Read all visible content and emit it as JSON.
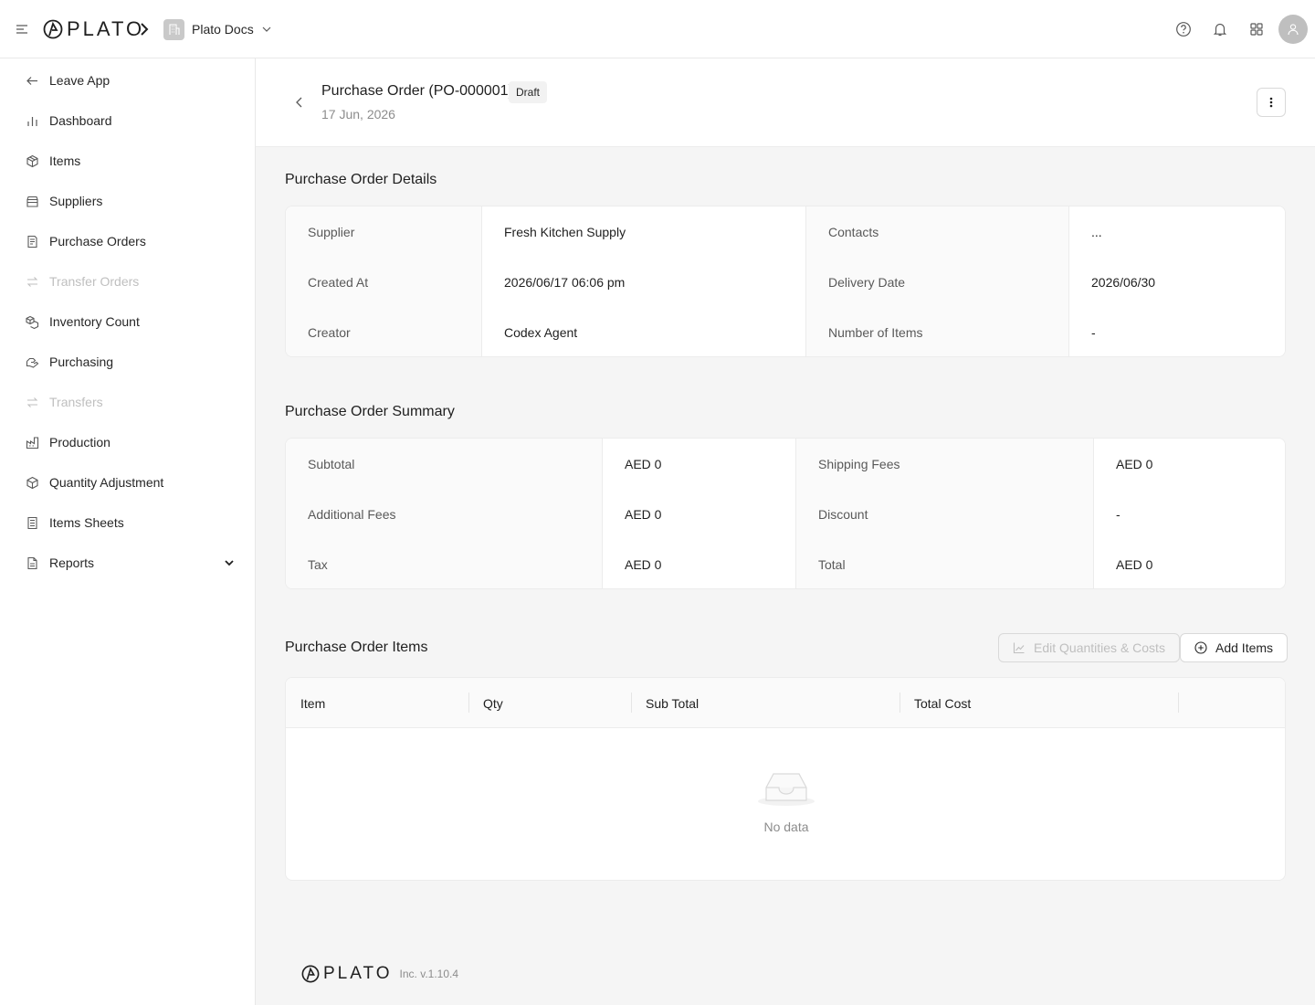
{
  "topbar": {
    "logo_text": "PLATO",
    "workspace_name": "Plato Docs"
  },
  "sidebar": {
    "items": [
      {
        "label": "Leave App",
        "icon": "arrow-left-icon",
        "disabled": false
      },
      {
        "label": "Dashboard",
        "icon": "bar-chart-icon",
        "disabled": false
      },
      {
        "label": "Items",
        "icon": "box-icon",
        "disabled": false
      },
      {
        "label": "Suppliers",
        "icon": "store-icon",
        "disabled": false
      },
      {
        "label": "Purchase Orders",
        "icon": "receipt-icon",
        "disabled": false
      },
      {
        "label": "Transfer Orders",
        "icon": "transfer-icon",
        "disabled": true
      },
      {
        "label": "Inventory Count",
        "icon": "boxes-icon",
        "disabled": false
      },
      {
        "label": "Purchasing",
        "icon": "purchasing-icon",
        "disabled": false
      },
      {
        "label": "Transfers",
        "icon": "transfer-icon",
        "disabled": true
      },
      {
        "label": "Production",
        "icon": "factory-icon",
        "disabled": false
      },
      {
        "label": "Quantity Adjustment",
        "icon": "box-icon",
        "disabled": false
      },
      {
        "label": "Items Sheets",
        "icon": "sheet-icon",
        "disabled": false
      },
      {
        "label": "Reports",
        "icon": "report-icon",
        "disabled": false
      }
    ]
  },
  "header": {
    "title": "Purchase Order (PO-000001)",
    "status": "Draft",
    "date": "17 Jun, 2026"
  },
  "details": {
    "title": "Purchase Order Details",
    "rows": [
      {
        "l1": "Supplier",
        "v1": "Fresh Kitchen Supply",
        "l2": "Contacts",
        "v2": "..."
      },
      {
        "l1": "Created At",
        "v1": "2026/06/17 06:06 pm",
        "l2": "Delivery Date",
        "v2": "2026/06/30"
      },
      {
        "l1": "Creator",
        "v1": "Codex Agent",
        "l2": "Number of Items",
        "v2": "-"
      }
    ]
  },
  "summary": {
    "title": "Purchase Order Summary",
    "rows": [
      {
        "l1": "Subtotal",
        "v1": "AED 0",
        "l2": "Shipping Fees",
        "v2": "AED 0"
      },
      {
        "l1": "Additional Fees",
        "v1": "AED 0",
        "l2": "Discount",
        "v2": "-"
      },
      {
        "l1": "Tax",
        "v1": "AED 0",
        "l2": "Total",
        "v2": "AED 0"
      }
    ]
  },
  "items": {
    "title": "Purchase Order Items",
    "edit_label": "Edit Quantities & Costs",
    "add_label": "Add Items",
    "columns": [
      "Item",
      "Qty",
      "Sub Total",
      "Total Cost"
    ],
    "empty_text": "No data"
  },
  "footer": {
    "logo_text": "PLATO",
    "version": "Inc. v.1.10.4"
  }
}
